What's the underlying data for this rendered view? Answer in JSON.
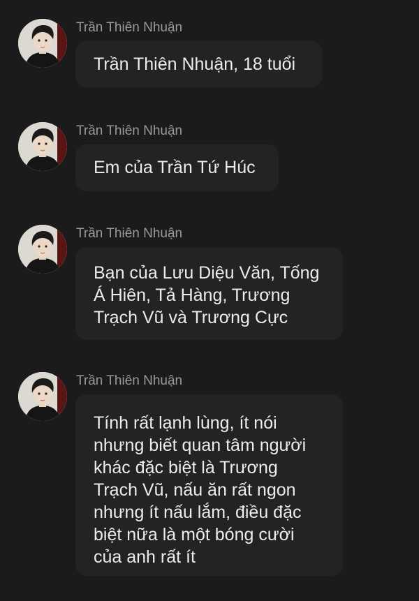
{
  "messages": [
    {
      "sender": "Trần Thiên Nhuận",
      "text": "Trần Thiên Nhuận, 18 tuổi"
    },
    {
      "sender": "Trần Thiên Nhuận",
      "text": "Em của Trần Tứ Húc"
    },
    {
      "sender": "Trần Thiên Nhuận",
      "text": "Bạn của Lưu Diệu Văn, Tống Á Hiên, Tả Hàng, Trương Trạch Vũ và Trương Cực"
    },
    {
      "sender": "Trần Thiên Nhuận",
      "text": "Tính rất lạnh lùng, ít nói nhưng biết quan tâm người khác đặc biệt là Trương Trạch Vũ, nấu ăn rất ngon nhưng ít nấu lắm, điều đặc biệt nữa là một bóng cười của anh rất ít"
    }
  ],
  "colors": {
    "background": "#1b1b1c",
    "bubble": "#232324",
    "sender_name": "#9a9a9a",
    "message_text": "#ececec"
  },
  "icons": {
    "avatar": "profile-photo-avatar"
  }
}
